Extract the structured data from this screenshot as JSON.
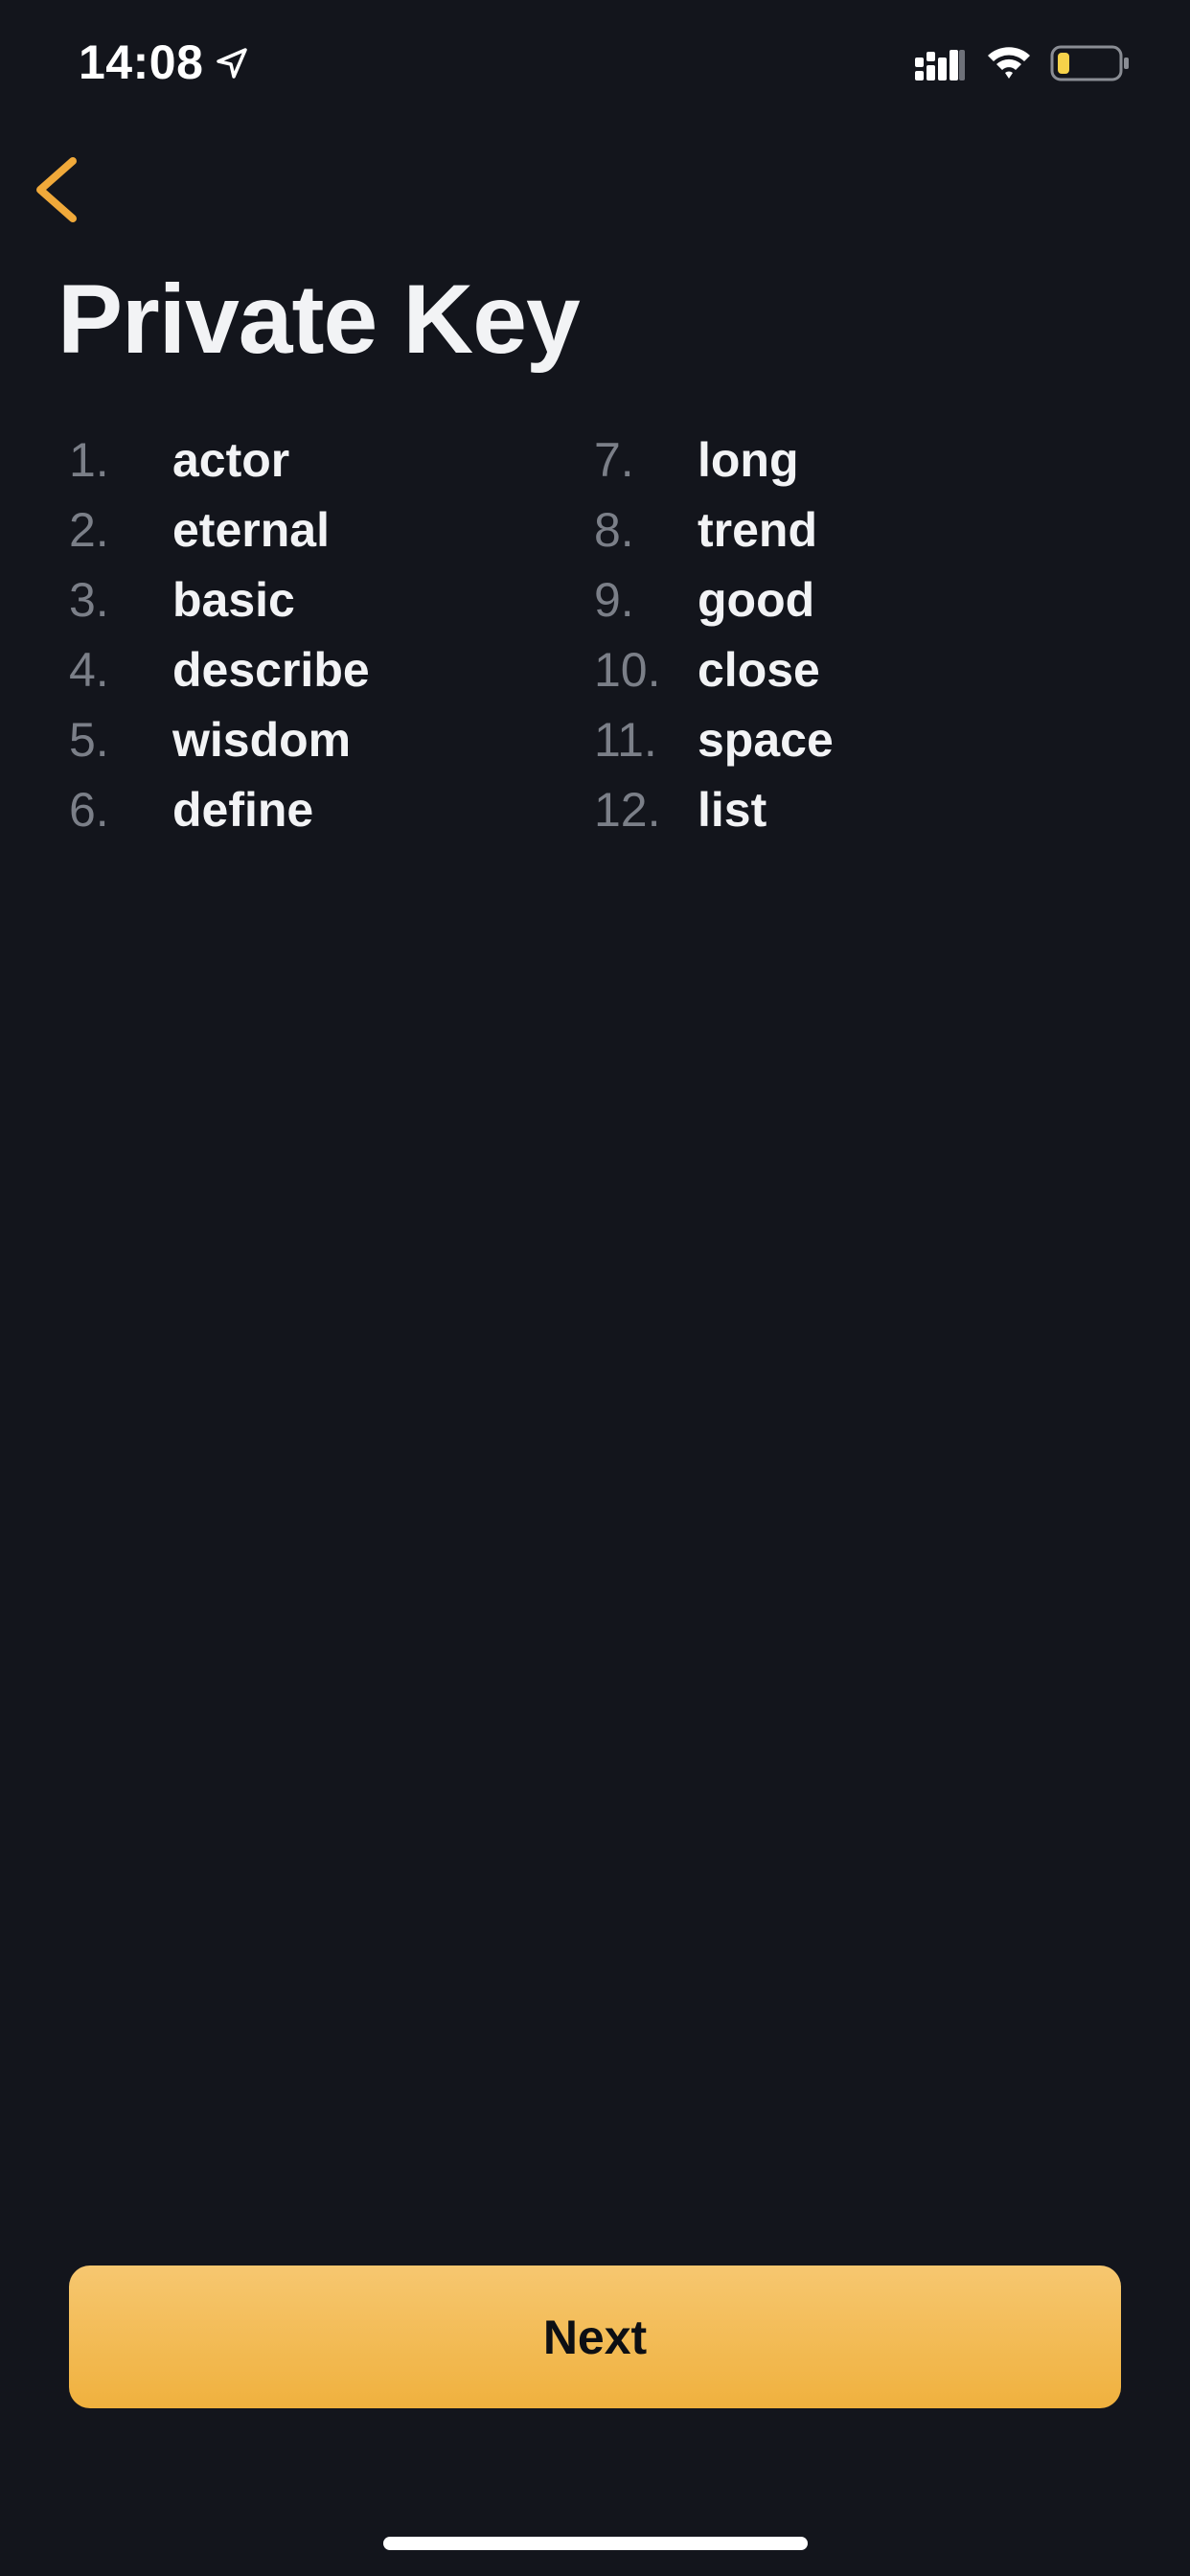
{
  "status_bar": {
    "time": "14:08",
    "icons": [
      "location-arrow-icon",
      "cellular-signal-icon",
      "wifi-icon",
      "battery-icon"
    ],
    "battery_level": 0.2
  },
  "header": {
    "back_icon": "chevron-left-icon",
    "title": "Private Key"
  },
  "words": [
    {
      "num": "1.",
      "word": "actor"
    },
    {
      "num": "2.",
      "word": "eternal"
    },
    {
      "num": "3.",
      "word": "basic"
    },
    {
      "num": "4.",
      "word": "describe"
    },
    {
      "num": "5.",
      "word": "wisdom"
    },
    {
      "num": "6.",
      "word": "define"
    },
    {
      "num": "7.",
      "word": "long"
    },
    {
      "num": "8.",
      "word": "trend"
    },
    {
      "num": "9.",
      "word": "good"
    },
    {
      "num": "10.",
      "word": "close"
    },
    {
      "num": "11.",
      "word": "space"
    },
    {
      "num": "12.",
      "word": "list"
    }
  ],
  "footer": {
    "next_label": "Next"
  },
  "colors": {
    "background": "#13151c",
    "accent": "#f0b13e",
    "number": "#7b7f88",
    "text": "#f2f3f5"
  }
}
